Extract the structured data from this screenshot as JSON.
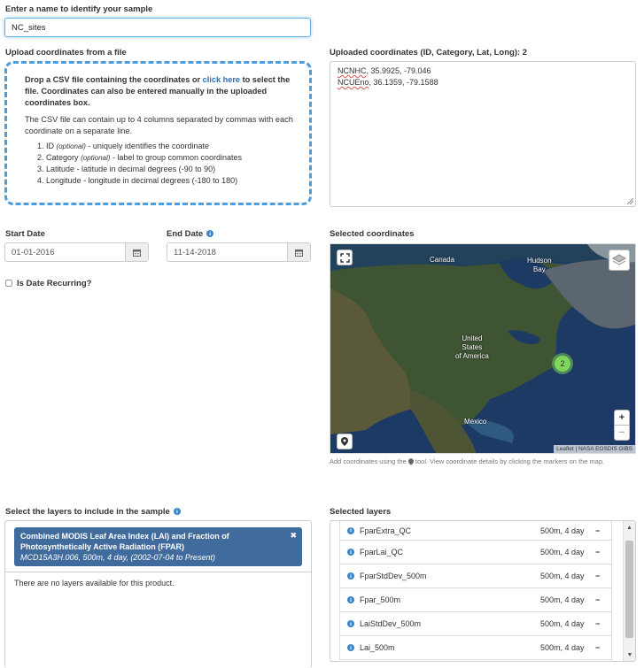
{
  "sample_name": {
    "label": "Enter a name to identify your sample",
    "value": "NC_sites"
  },
  "upload": {
    "label": "Upload coordinates from a file",
    "drop_text_1": "Drop a CSV file containing the coordinates or ",
    "drop_link": "click here",
    "drop_text_2": " to select the file. Coordinates can also be entered manually in the uploaded coordinates box.",
    "csv_intro": "The CSV file can contain up to 4 columns separated by commas with each coordinate on a separate line.",
    "columns": [
      {
        "num": "1.",
        "name": "ID",
        "note": "(optional)",
        "desc": " - uniquely identifies the coordinate"
      },
      {
        "num": "2.",
        "name": "Category",
        "note": "(optional)",
        "desc": " - label to group common coordinates"
      },
      {
        "num": "3.",
        "name": "Latitude",
        "note": "",
        "desc": " - latitude in decimal degrees (-90 to 90)"
      },
      {
        "num": "4.",
        "name": "Longitude",
        "note": "",
        "desc": " - longitude in decimal degrees (-180 to 180)"
      }
    ]
  },
  "uploaded_coords": {
    "label": "Uploaded coordinates (ID, Category, Lat, Long): 2",
    "rows": [
      {
        "id": "NCNHC",
        "rest": ", 35.9925, -79.046"
      },
      {
        "id": "NCUEno",
        "rest": ", 36.1359, -79.1588"
      }
    ]
  },
  "dates": {
    "start_label": "Start Date",
    "start_value": "01-01-2016",
    "end_label": "End Date",
    "end_value": "11-14-2018",
    "recurring_label": "Is Date Recurring?"
  },
  "map": {
    "label": "Selected coordinates",
    "places": {
      "canada": "Canada",
      "hudson": "Hudson\nBay",
      "usa": "United\nStates\nof America",
      "mexico": "Mexico"
    },
    "cluster_count": "2",
    "attribution": "Leaflet | NASA EOSDIS GIBS",
    "hint_before": "Add coordinates using the ",
    "hint_after": " tool. View coordinate details by clicking the markers on the map.",
    "zoom_in": "+",
    "zoom_out": "−",
    "icons": {
      "fullscreen": "fullscreen-icon",
      "layers": "layers-icon",
      "marker": "map-marker-icon"
    }
  },
  "layers": {
    "label": "Select the layers to include in the sample",
    "product_title": "Combined MODIS Leaf Area Index (LAI) and Fraction of Photosynthetically Active Radiation (FPAR)",
    "product_sub": "MCD15A3H.006, 500m, 4 day, (2002-07-04 to Present)",
    "close": "✖",
    "empty_msg": "There are no layers available for this product."
  },
  "selected_layers": {
    "label": "Selected layers",
    "items": [
      {
        "name": "FparExtra_QC",
        "res": "500m, 4 day"
      },
      {
        "name": "FparLai_QC",
        "res": "500m, 4 day"
      },
      {
        "name": "FparStdDev_500m",
        "res": "500m, 4 day"
      },
      {
        "name": "Fpar_500m",
        "res": "500m, 4 day"
      },
      {
        "name": "LaiStdDev_500m",
        "res": "500m, 4 day"
      },
      {
        "name": "Lai_500m",
        "res": "500m, 4 day"
      }
    ],
    "remove": "−",
    "info": "i"
  },
  "colors": {
    "accent": "#4a9ee0",
    "product_bg": "#416b9c",
    "cluster": "#7fd65a"
  }
}
